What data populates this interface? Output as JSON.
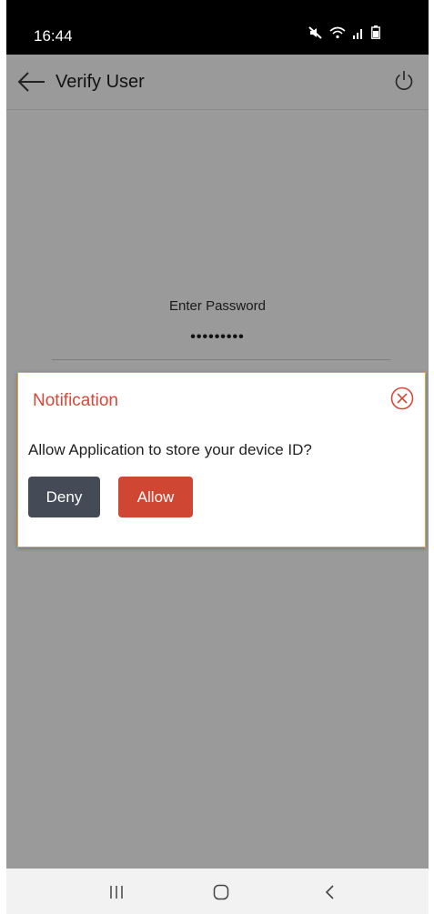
{
  "status_bar": {
    "time": "16:44",
    "icons": [
      "mute-icon",
      "wifi-icon",
      "signal-icon",
      "battery-icon"
    ]
  },
  "app_bar": {
    "title": "Verify User",
    "back_icon": "arrow-left-icon",
    "power_icon": "power-icon"
  },
  "password": {
    "label": "Enter Password",
    "value": "•••••••••"
  },
  "dialog": {
    "title": "Notification",
    "message": "Allow Application to store your device ID?",
    "deny_label": "Deny",
    "allow_label": "Allow",
    "close_icon": "circle-x-icon"
  },
  "nav_bar": {
    "icons": [
      "recents-icon",
      "home-icon",
      "back-icon"
    ]
  },
  "colors": {
    "overlay_background": "#9a9a9a",
    "dialog_title": "#d04a3a",
    "dialog_border": "#e0a63b",
    "deny_button": "#454b56",
    "allow_button": "#cf4632"
  }
}
